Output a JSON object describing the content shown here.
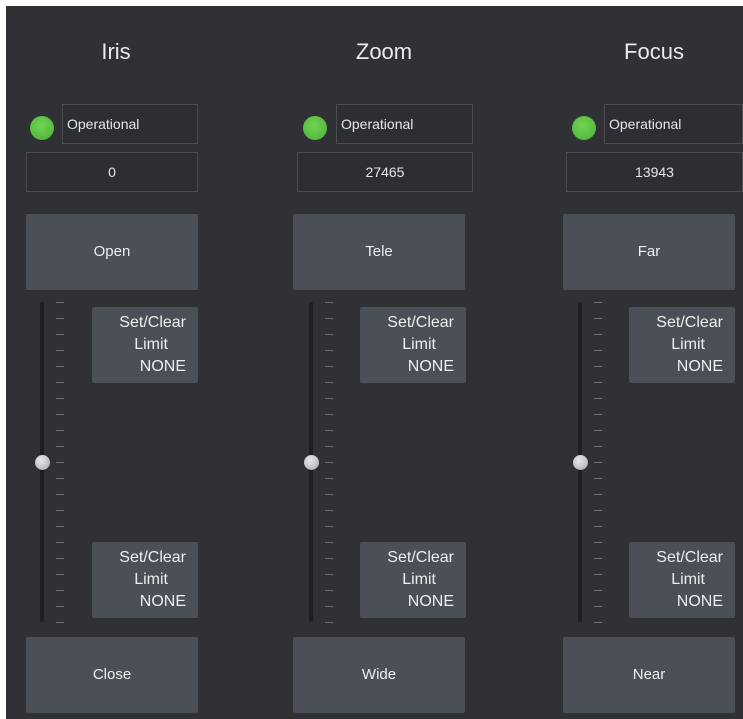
{
  "colors": {
    "background": "#2f3135",
    "button": "#4b4f57",
    "status_led": "#5fc24a",
    "text": "#e9eaec"
  },
  "columns": [
    {
      "title": "Iris",
      "status": "Operational",
      "value": "0",
      "top_button": "Open",
      "bottom_button": "Close",
      "upper_limit": {
        "line1": "Set/Clear",
        "line2": "Limit",
        "line3": "NONE"
      },
      "lower_limit": {
        "line1": "Set/Clear",
        "line2": "Limit",
        "line3": "NONE"
      },
      "slider_level": 0.5
    },
    {
      "title": "Zoom",
      "status": "Operational",
      "value": "27465",
      "top_button": "Tele",
      "bottom_button": "Wide",
      "upper_limit": {
        "line1": "Set/Clear",
        "line2": "Limit",
        "line3": "NONE"
      },
      "lower_limit": {
        "line1": "Set/Clear",
        "line2": "Limit",
        "line3": "NONE"
      },
      "slider_level": 0.5
    },
    {
      "title": "Focus",
      "status": "Operational",
      "value": "13943",
      "top_button": "Far",
      "bottom_button": "Near",
      "upper_limit": {
        "line1": "Set/Clear",
        "line2": "Limit",
        "line3": "NONE"
      },
      "lower_limit": {
        "line1": "Set/Clear",
        "line2": "Limit",
        "line3": "NONE"
      },
      "slider_level": 0.5
    }
  ]
}
